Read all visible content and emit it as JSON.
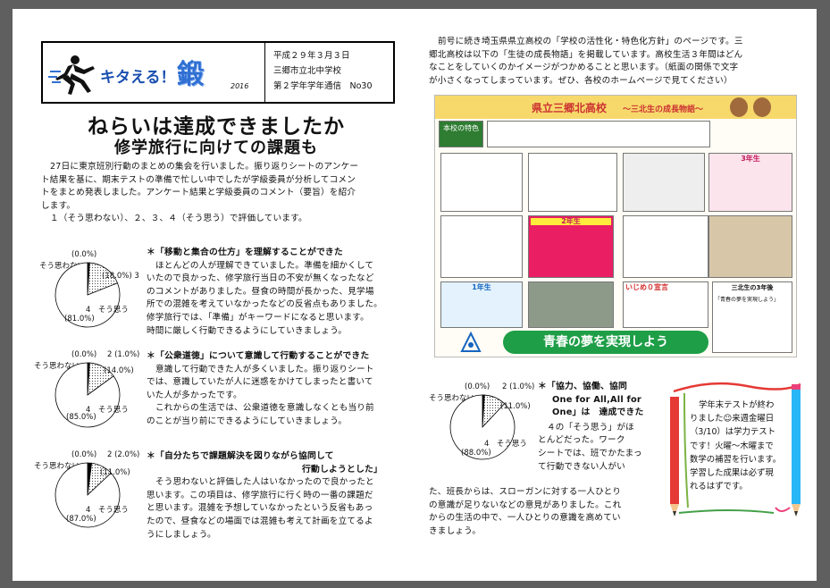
{
  "header": {
    "logo_title": "キタえる！",
    "logo_kanji": "鍛",
    "logo_year": "2016",
    "date": "平成２９年３月３日",
    "school": "三郷市立北中学校",
    "issue": "第２学年学年通信　No30"
  },
  "title": "ねらいは達成できましたか",
  "subtitle": "修学旅行に向けての課題も",
  "intro": [
    "27日に東京班別行動のまとめの集会を行いました。振り返りシートのアンケー",
    "ト結果を基に、期末テストの準備で忙しい中でしたが学級委員が分析してコメン",
    "トをまとめ発表しました。アンケート結果と学級委員のコメント（要旨）を紹介",
    "します。"
  ],
  "scale_note": "１（そう思わない）、２、３、４（そう思う）で評価しています。",
  "sections": [
    {
      "heading": "＊「移動と集合の仕方」を理解することができた",
      "body": [
        "ほとんどの人が理解できていました。準備を細かくして",
        "いたので良かった、修学旅行当日の不安が無くなったなど",
        "のコメントがありました。昼食の時間が長かった、見学場",
        "所での混雑を考えていなかったなどの反省点もありました。",
        "修学旅行では、「準備」がキーワードになると思います。",
        "時間に厳しく行動できるようにしていきましょう。"
      ],
      "pie": {
        "top_label": "(0.0%)",
        "left_label": "そう思わない",
        "mid": "(18.0%) 3",
        "bottom_left": "(81.0%)",
        "bottom": "4　そう思う",
        "segments": [
          0.81,
          0.18,
          0.01
        ]
      }
    },
    {
      "heading": "＊「公衆道徳」について意識して行動することができた",
      "body": [
        "意識して行動できた人が多くいました。振り返りシート",
        "では、意識していたが人に迷惑をかけてしまったと書いて",
        "いた人が多かったです。",
        "これからの生活では、公衆道徳を意識しなくとも当り前",
        "のことが当り前にできるようにしていきましょう。"
      ],
      "pie": {
        "top_label": "(0.0%)",
        "right_label": "2 (1.0%)",
        "left_label": "そう思わない",
        "mid": "(14.0%)",
        "bottom_left": "(85.0%)",
        "bottom": "4　そう思う",
        "segments": [
          0.85,
          0.14,
          0.01
        ]
      }
    },
    {
      "heading": "＊「自分たちで課題解決を図りながら協同して",
      "heading2": "行動しようとした」",
      "body": [
        "そう思わないと評価した人はいなかったので良かったと",
        "思います。この項目は、修学旅行に行く時の一番の課題だ",
        "と思います。混雑を予想していなかったという反省もあっ",
        "たので、昼食などの場面では混雑も考えて計画を立てるよ",
        "うにしましょう。"
      ],
      "pie": {
        "top_label": "(0.0%)",
        "right_label": "2 (2.0%)",
        "left_label": "そう思わない",
        "mid": "(11.0%)",
        "bottom_left": "(87.0%)",
        "bottom": "4　そう思う",
        "segments": [
          0.87,
          0.11,
          0.02
        ]
      }
    }
  ],
  "right_intro": [
    "前号に続き埼玉県県立高校の「学校の活性化・特色化方針」のページです。三",
    "郷北高校は以下の「生徒の成長物語」を掲載しています。高校生活３年間はどん",
    "なことをしていくのかイメージがつかめることと思います。（紙面の関係で文字",
    "が小さくなってしまっています。ぜひ、各校のホームページで見てください）"
  ],
  "poster": {
    "title": "県立三郷北高校",
    "subtitle": "～三北生の成長物語～",
    "feature_label": "本校の特色",
    "slogan": "青春の夢を実現しよう",
    "year1": "1年生",
    "year2": "2年生",
    "year3": "3年生",
    "ikiji": "いじめ０宣言",
    "sanbokusei": "三北生の3年後",
    "dream": "「青春の夢を実現しよう」"
  },
  "section4": {
    "heading1": "＊「協力、協働、協同",
    "heading2": "One for All,All for",
    "heading3": "One」は　達成できた",
    "body_right": [
      "４の「そう思う」がほ",
      "とんどだった。ワーク",
      "シートでは、班でかたまっ",
      "て行動できない人がい"
    ],
    "body_full": [
      "た、班長からは、スローガンに対する一人ひとり",
      "の意識が足りないなどの意見がありました。これ",
      "からの生活の中で、一人ひとりの意識を高めてい",
      "きましょう。"
    ],
    "pie": {
      "top_label": "(0.0%)",
      "right_label": "2 (1.0%)",
      "left_label": "そう思わない",
      "mid": "(11.0%)",
      "bottom_left": "(88.0%)",
      "bottom": "4　そう思う",
      "segments": [
        0.88,
        0.11,
        0.01
      ]
    }
  },
  "message": [
    "学年末テストが終わ",
    "りました☺来週金曜日",
    "（3/10）は学力テスト",
    "です！火曜～木曜まで",
    "数学の補習を行います。",
    "学習した成果は必ず現",
    "れるはずです。"
  ]
}
